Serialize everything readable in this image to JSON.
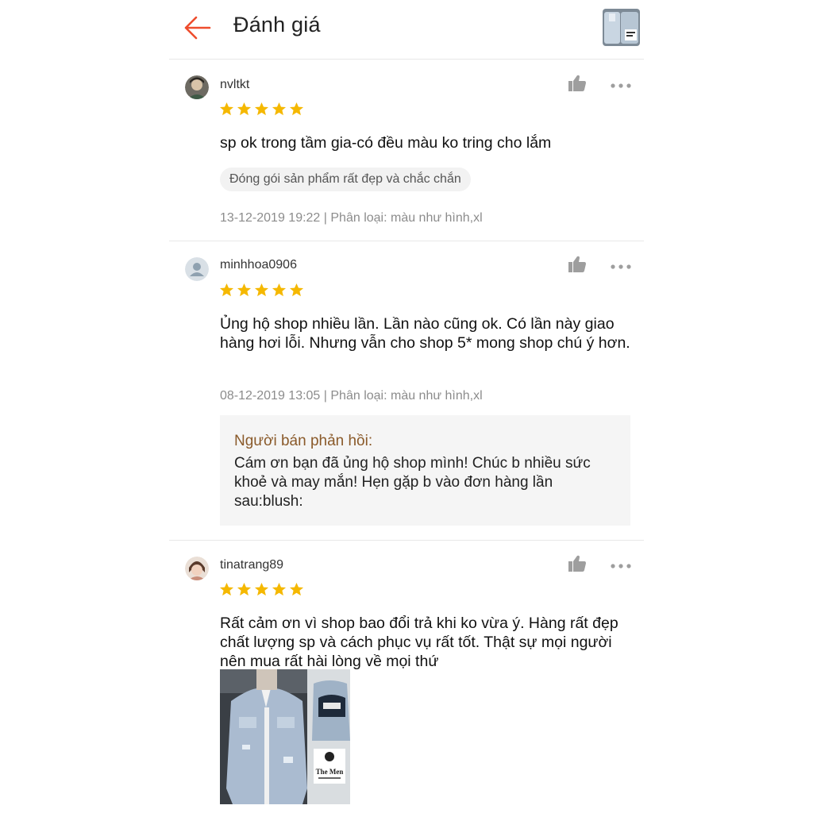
{
  "header": {
    "title": "Đánh giá",
    "back_icon": "arrow-left-icon",
    "accent_color": "#ee4d2d"
  },
  "reviews": [
    {
      "username": "nvltkt",
      "rating": 5,
      "comment": "sp ok trong tầm gia-có đều màu ko tring cho lắm",
      "tag": "Đóng gói sản phẩm rất đẹp và chắc chắn",
      "meta": "13-12-2019 19:22 | Phân loại: màu như hình,xl"
    },
    {
      "username": "minhhoa0906",
      "rating": 5,
      "comment": "Ủng hộ shop nhiều lần. Lần nào cũng ok. Có lần này giao hàng hơi lỗi. Nhưng vẫn cho shop 5*  mong shop chú ý hơn.",
      "meta": "08-12-2019 13:05 | Phân loại: màu như hình,xl",
      "seller_reply": {
        "title": "Người bán phản hồi:",
        "text": "Cám ơn bạn đã ủng hộ shop mình! Chúc b nhiều sức khoẻ và may mắn! Hẹn gặp b vào đơn hàng lần sau:blush:"
      }
    },
    {
      "username": "tinatrang89",
      "rating": 5,
      "comment": "Rất cảm ơn vì shop bao đổi trả khi ko vừa ý. Hàng rất đẹp chất lượng sp và cách phục vụ rất tốt. Thật sự mọi người nên mua rất hài lòng về mọi thứ",
      "photo_logo": "The Men"
    }
  ],
  "icons": {
    "like": "thumbs-up-icon",
    "more": "more-options-icon",
    "star": "star-icon",
    "star_color": "#f5b800"
  }
}
